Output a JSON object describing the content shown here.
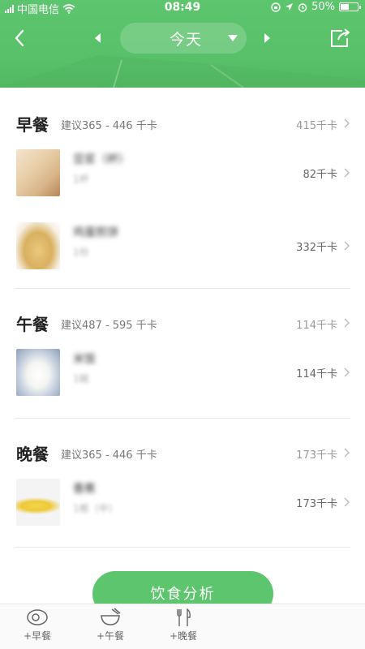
{
  "status_bar": {
    "carrier": "中国电信",
    "time": "08:49",
    "battery": "50%",
    "battery_level": 0.5
  },
  "nav": {
    "date_label": "今天"
  },
  "meals": [
    {
      "title": "早餐",
      "suggestion": "建议365 - 446 千卡",
      "total": "415千卡",
      "items": [
        {
          "name": "豆浆（杯）",
          "amount": "1杯",
          "kcal": "82千卡"
        },
        {
          "name": "鸡蛋煎饼",
          "amount": "1份",
          "kcal": "332千卡"
        }
      ]
    },
    {
      "title": "午餐",
      "suggestion": "建议487 - 595 千卡",
      "total": "114千卡",
      "items": [
        {
          "name": "米饭",
          "amount": "1碗",
          "kcal": "114千卡"
        }
      ]
    },
    {
      "title": "晚餐",
      "suggestion": "建议365 - 446 千卡",
      "total": "173千卡",
      "items": [
        {
          "name": "香蕉",
          "amount": "1根（中）",
          "kcal": "173千卡"
        }
      ]
    }
  ],
  "analysis_button": "饮食分析",
  "tabbar": {
    "breakfast": "+早餐",
    "lunch": "+午餐",
    "dinner": "+晚餐"
  },
  "colors": {
    "brand_green": "#5cc56d"
  }
}
